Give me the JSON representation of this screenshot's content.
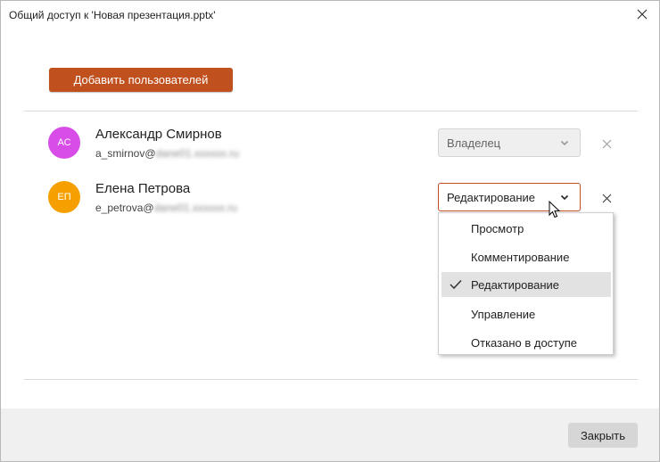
{
  "window": {
    "title": "Общий доступ к 'Новая презентация.pptx'"
  },
  "actions": {
    "add_users_label": "Добавить пользователей"
  },
  "users": [
    {
      "initials": "АС",
      "name": "Александр Смирнов",
      "email_local": "a_smirnov@",
      "email_domain": "dane01.xxxxxx.ru",
      "role": "Владелец",
      "avatar_color": "#d84de8"
    },
    {
      "initials": "ЕП",
      "name": "Елена Петрова",
      "email_local": "e_petrova@",
      "email_domain": "dane01.xxxxxx.ru",
      "role": "Редактирование",
      "avatar_color": "#f5a000"
    }
  ],
  "role_menu": {
    "options": [
      "Просмотр",
      "Комментирование",
      "Редактирование",
      "Управление",
      "Отказано в доступе"
    ],
    "selected": "Редактирование"
  },
  "footer": {
    "close_label": "Закрыть"
  },
  "colors": {
    "accent": "#c1501f",
    "footer_bg": "#f0f0f0"
  }
}
